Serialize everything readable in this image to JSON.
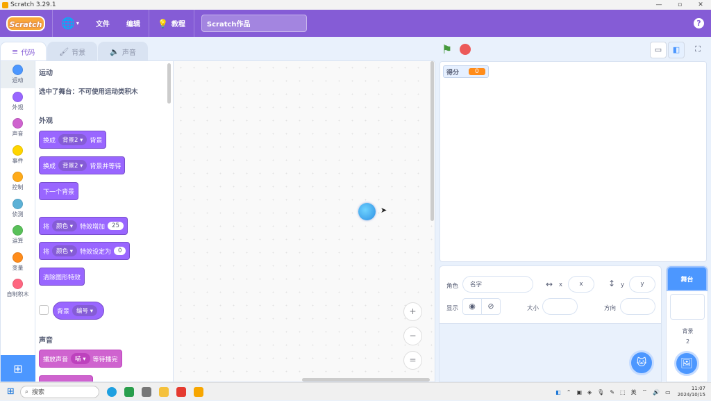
{
  "window": {
    "title": "Scratch 3.29.1",
    "minimize": "—",
    "restore": "▫",
    "close": "✕"
  },
  "menubar": {
    "logo": "Scratch",
    "language_icon": "globe-icon",
    "file": "文件",
    "edit": "编辑",
    "tutorials": "教程",
    "project_title": "Scratch作品",
    "help": "?"
  },
  "tabs": [
    {
      "label": "代码",
      "icon": "code-icon",
      "active": true
    },
    {
      "label": "背景",
      "icon": "brush-icon",
      "active": false
    },
    {
      "label": "声音",
      "icon": "speaker-icon",
      "active": false
    }
  ],
  "categories": [
    {
      "label": "运动",
      "color": "#4c97ff"
    },
    {
      "label": "外观",
      "color": "#9966ff"
    },
    {
      "label": "声音",
      "color": "#cf63cf"
    },
    {
      "label": "事件",
      "color": "#ffd500"
    },
    {
      "label": "控制",
      "color": "#ffab19"
    },
    {
      "label": "侦测",
      "color": "#5cb1d6"
    },
    {
      "label": "运算",
      "color": "#59c059"
    },
    {
      "label": "变量",
      "color": "#ff8c1a"
    },
    {
      "label": "自制积木",
      "color": "#ff6680"
    }
  ],
  "palette": {
    "motion_title": "运动",
    "motion_note": "选中了舞台：不可使用运动类积木",
    "looks_title": "外观",
    "sound_title": "声音",
    "blocks": {
      "b1": {
        "prefix": "换成",
        "dropdown": "背景2",
        "suffix": "背景"
      },
      "b2": {
        "prefix": "换成",
        "dropdown": "背景2",
        "suffix": "背景并等待"
      },
      "b3": {
        "text": "下一个背景"
      },
      "b4": {
        "prefix": "将",
        "dropdown": "颜色",
        "mid": "特效增加",
        "value": "25"
      },
      "b5": {
        "prefix": "将",
        "dropdown": "颜色",
        "mid": "特效设定为",
        "value": "0"
      },
      "b6": {
        "text": "清除图形特效"
      },
      "b7": {
        "prefix": "背景",
        "dropdown": "编号"
      },
      "b8": {
        "prefix": "播放声音",
        "dropdown": "喵",
        "suffix": "等待播完"
      }
    }
  },
  "zoom": {
    "in": "+",
    "out": "−",
    "reset": "="
  },
  "stage_header": {
    "green_flag": "⚑",
    "small_stage": "▭",
    "normal_stage": "◧",
    "fullscreen": "⛶"
  },
  "stage": {
    "monitor_label": "得分",
    "monitor_value": "0"
  },
  "sprite_info": {
    "sprite_label": "角色",
    "name_placeholder": "名字",
    "x_label": "x",
    "x_placeholder": "x",
    "y_label": "y",
    "y_placeholder": "y",
    "show_label": "显示",
    "size_label": "大小",
    "direction_label": "方向"
  },
  "stage_pane": {
    "title": "舞台",
    "backdrops_label": "背景",
    "backdrops_count": "2"
  },
  "taskbar": {
    "search": "搜索",
    "lang": "英",
    "time": "11:07",
    "date": "2024/10/15"
  }
}
